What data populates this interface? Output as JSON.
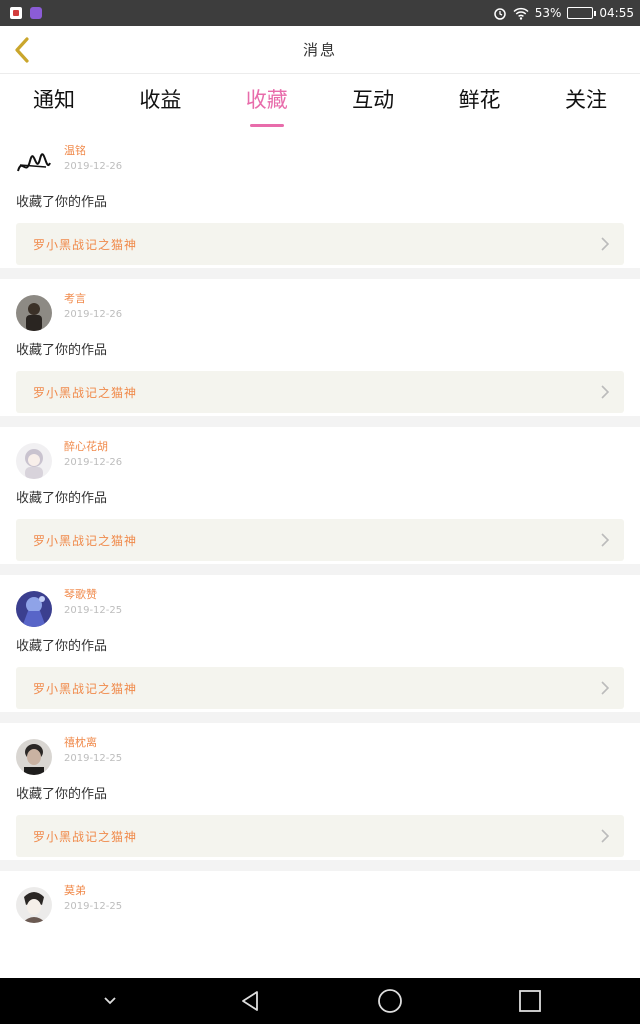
{
  "status": {
    "battery_percent": "53%",
    "time": "04:55",
    "battery_level": 0.53
  },
  "header": {
    "title": "消息"
  },
  "tabs": [
    {
      "label": "通知",
      "active": false
    },
    {
      "label": "收益",
      "active": false
    },
    {
      "label": "收藏",
      "active": true
    },
    {
      "label": "互动",
      "active": false
    },
    {
      "label": "鲜花",
      "active": false
    },
    {
      "label": "关注",
      "active": false
    }
  ],
  "colors": {
    "accent": "#e86cab",
    "username": "#f08a4b",
    "card_bg": "#f4f4ee"
  },
  "items": [
    {
      "username": "温铭",
      "date": "2019-12-26",
      "action": "收藏了你的作品",
      "work": "罗小黑战记之猫神",
      "avatar": "signature"
    },
    {
      "username": "考言",
      "date": "2019-12-26",
      "action": "收藏了你的作品",
      "work": "罗小黑战记之猫神",
      "avatar": "photo"
    },
    {
      "username": "醉心花胡",
      "date": "2019-12-26",
      "action": "收藏了你的作品",
      "work": "罗小黑战记之猫神",
      "avatar": "anime-girl"
    },
    {
      "username": "琴歌赞",
      "date": "2019-12-25",
      "action": "收藏了你的作品",
      "work": "罗小黑战记之猫神",
      "avatar": "blue-anime"
    },
    {
      "username": "禧枕离",
      "date": "2019-12-25",
      "action": "收藏了你的作品",
      "work": "罗小黑战记之猫神",
      "avatar": "portrait"
    },
    {
      "username": "莫弟",
      "date": "2019-12-25",
      "action": "",
      "work": "",
      "avatar": "sketch"
    }
  ]
}
